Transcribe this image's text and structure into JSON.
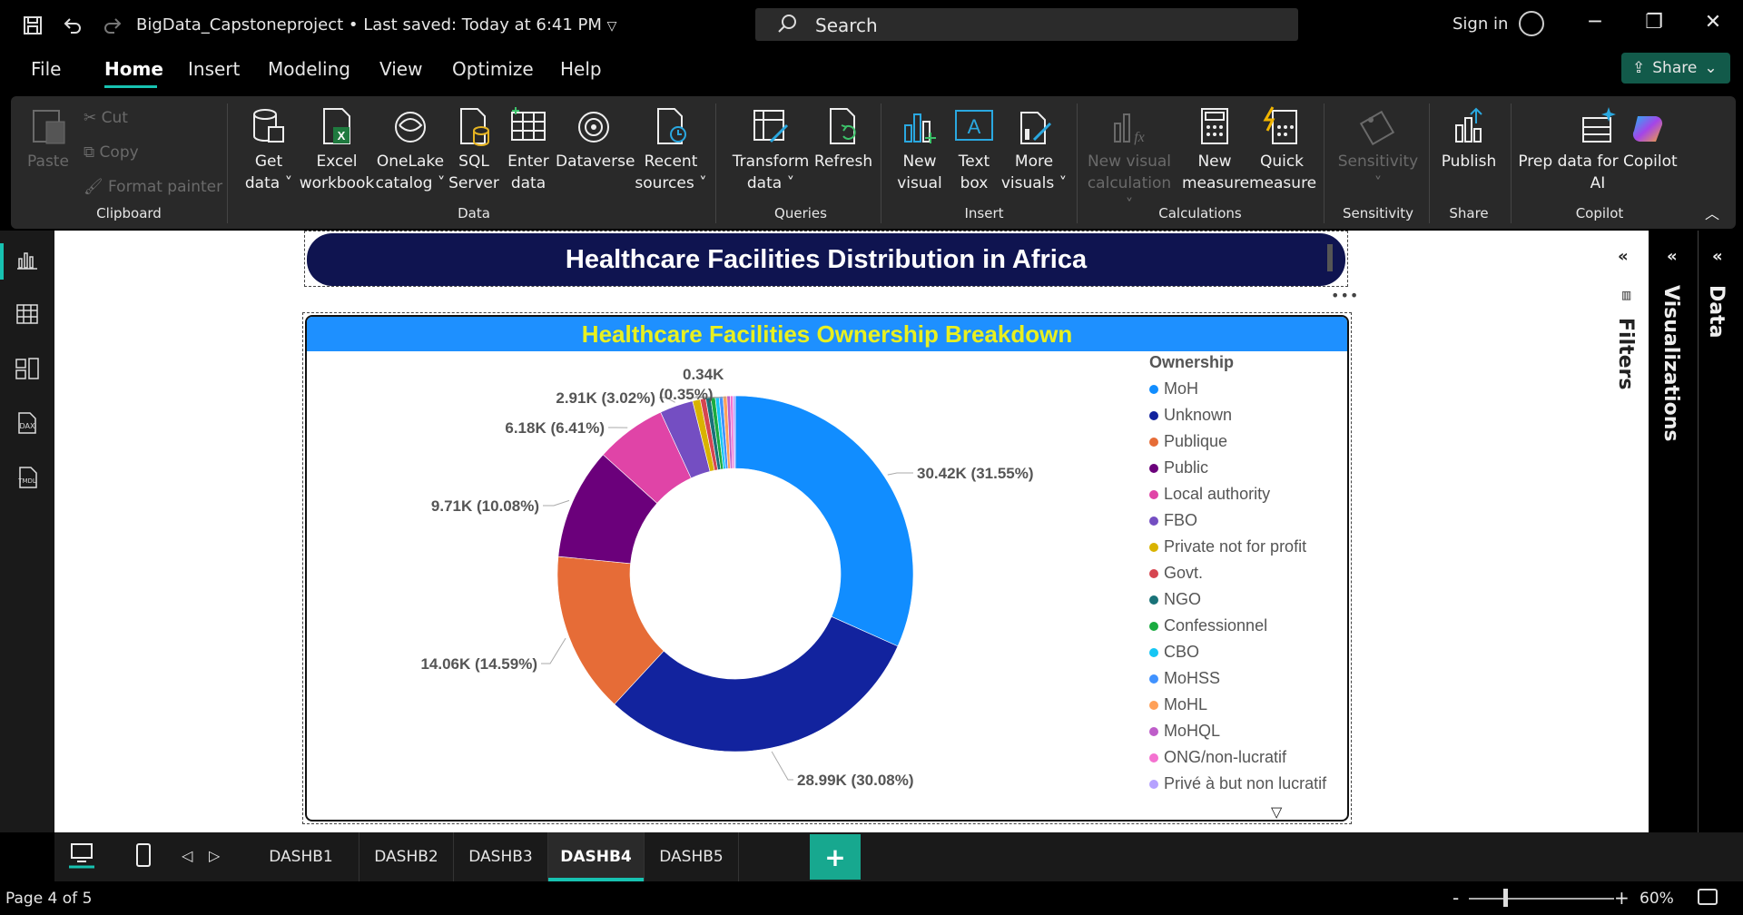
{
  "titlebar": {
    "doc_title": "BigData_Capstoneproject • Last saved: Today at 6:41 PM",
    "search_placeholder": "Search",
    "sign_in": "Sign in"
  },
  "menubar": {
    "items": [
      "File",
      "Home",
      "Insert",
      "Modeling",
      "View",
      "Optimize",
      "Help"
    ],
    "active": "Home",
    "share_label": "Share"
  },
  "ribbon": {
    "clipboard": {
      "paste": "Paste",
      "cut": "Cut",
      "copy": "Copy",
      "format_painter": "Format painter",
      "label": "Clipboard"
    },
    "data": {
      "label": "Data",
      "buttons": [
        {
          "line1": "Get",
          "line2": "data ˅"
        },
        {
          "line1": "Excel",
          "line2": "workbook"
        },
        {
          "line1": "OneLake",
          "line2": "catalog ˅"
        },
        {
          "line1": "SQL",
          "line2": "Server"
        },
        {
          "line1": "Enter",
          "line2": "data"
        },
        {
          "line1": "Dataverse",
          "line2": ""
        },
        {
          "line1": "Recent",
          "line2": "sources ˅"
        }
      ]
    },
    "queries": {
      "label": "Queries",
      "buttons": [
        {
          "line1": "Transform",
          "line2": "data ˅"
        },
        {
          "line1": "Refresh",
          "line2": ""
        }
      ]
    },
    "insert": {
      "label": "Insert",
      "buttons": [
        {
          "line1": "New",
          "line2": "visual"
        },
        {
          "line1": "Text",
          "line2": "box"
        },
        {
          "line1": "More",
          "line2": "visuals ˅"
        }
      ]
    },
    "calculations": {
      "label": "Calculations",
      "buttons": [
        {
          "line1": "New visual",
          "line2": "calculation ˅"
        },
        {
          "line1": "New",
          "line2": "measure"
        },
        {
          "line1": "Quick",
          "line2": "measure"
        }
      ]
    },
    "sensitivity": {
      "label": "Sensitivity",
      "button": "Sensitivity",
      "arrow": "˅"
    },
    "share": {
      "label": "Share",
      "button": "Publish"
    },
    "copilot": {
      "label": "Copilot",
      "line1": "Prep data for Copilot",
      "line2": "AI"
    }
  },
  "report": {
    "banner_title": "Healthcare Facilities Distribution in Africa",
    "visual_title": "Healthcare Facilities Ownership Breakdown",
    "more_options": "•••"
  },
  "chart_data": {
    "type": "pie",
    "donut": true,
    "title": "Healthcare Facilities Ownership Breakdown",
    "legend_title": "Ownership",
    "legend_position": "right",
    "categories": [
      "MoH",
      "Unknown",
      "Publique",
      "Public",
      "Local authority",
      "FBO",
      "Private not for profit",
      "Govt.",
      "NGO",
      "Confessionnel",
      "CBO",
      "MoHSS",
      "MoHL",
      "MoHQL",
      "ONG/non-lucratif",
      "Privé à but non lucratif"
    ],
    "values": [
      31.55,
      30.08,
      14.59,
      10.08,
      6.41,
      3.02,
      0.7,
      0.5,
      0.45,
      0.4,
      0.35,
      0.35,
      0.35,
      0.3,
      0.25,
      0.2
    ],
    "colors": [
      "#118dff",
      "#12239e",
      "#e66c37",
      "#6b007b",
      "#e044a7",
      "#744ec2",
      "#d9b300",
      "#d64550",
      "#197278",
      "#1aab40",
      "#15c6f4",
      "#4092ff",
      "#ffa058",
      "#be5dc9",
      "#f472d0",
      "#b5a1ff"
    ],
    "data_labels": [
      {
        "slice": 0,
        "text": "30.42K (31.55%)"
      },
      {
        "slice": 1,
        "text": "28.99K (30.08%)"
      },
      {
        "slice": 2,
        "text": "14.06K (14.59%)"
      },
      {
        "slice": 3,
        "text": "9.71K (10.08%)"
      },
      {
        "slice": 4,
        "text": "6.18K (6.41%)"
      },
      {
        "slice": 5,
        "text": "2.91K (3.02%)"
      },
      {
        "slice": 6,
        "text": "0.34K (0.35%)"
      }
    ]
  },
  "pages": {
    "tabs": [
      "DASHB1",
      "DASHB2",
      "DASHB3",
      "DASHB4",
      "DASHB5"
    ],
    "active": "DASHB4",
    "add": "+"
  },
  "panes": {
    "filters": "Filters",
    "visualizations": "Visualizations",
    "data": "Data"
  },
  "status": {
    "page": "Page 4 of 5",
    "zoom": "60%",
    "minus": "-",
    "plus": "+"
  }
}
